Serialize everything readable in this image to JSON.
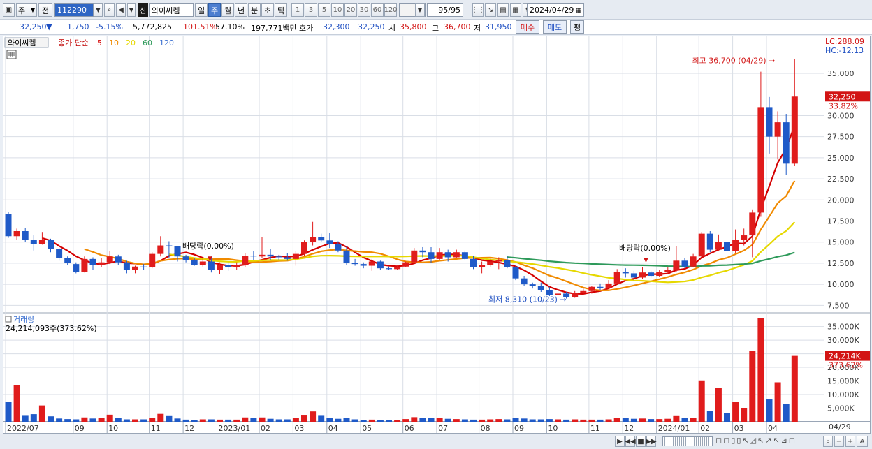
{
  "toolbar": {
    "period_sel": "주",
    "prev_label": "전",
    "code": "112290",
    "market_badge": "신",
    "name": "와이씨켐",
    "period_buttons": [
      "일",
      "주",
      "월",
      "년",
      "분",
      "초",
      "틱"
    ],
    "interval_buttons": [
      "1",
      "3",
      "5",
      "10",
      "20",
      "30",
      "60",
      "120"
    ],
    "count": "95/95",
    "date": "2024/04/29"
  },
  "quote": {
    "price": "32,250",
    "arrow": "▼",
    "change": "1,750",
    "change_pct": "-5.15%",
    "volume": "5,772,825",
    "vol_ratio": "101.51%",
    "turnover_ratio": "57.10%",
    "amount": "197,771백만",
    "hoga_label": "호가",
    "ask": "32,300",
    "bid": "32,250",
    "open_label": "시",
    "open": "35,800",
    "high_label": "고",
    "high": "36,700",
    "low_label": "저",
    "low": "31,950",
    "buy": "매수",
    "sell": "매도",
    "eval": "평"
  },
  "legend": {
    "name": "와이씨켐",
    "ma_label": "종가 단순",
    "ma": [
      {
        "p": "5",
        "color": "#d40000"
      },
      {
        "p": "10",
        "color": "#f08a00"
      },
      {
        "p": "20",
        "color": "#e6d800"
      },
      {
        "p": "60",
        "color": "#2e9a5a"
      },
      {
        "p": "120",
        "color": "#3a6fd0"
      }
    ]
  },
  "right_axis": {
    "lc": "LC:288.09",
    "hc": "HC:-12.13",
    "price_tag": "32,250",
    "price_pct": "33.82%",
    "vol_tag": "24,214K",
    "vol_pct": "373.62%",
    "last_date": "04/29"
  },
  "volume_panel": {
    "title": "거래량",
    "info": "24,214,093주(373.62%)"
  },
  "colors": {
    "up": "#e01c1c",
    "down": "#1f5ac8",
    "panel_bg": "#ffffff",
    "grid": "#d9dee6"
  },
  "chart_data": {
    "type": "candlestick",
    "price_yticks": [
      7500,
      10000,
      12500,
      15000,
      17500,
      20000,
      22500,
      25000,
      27500,
      30000,
      35000
    ],
    "ylim_price": [
      6700,
      37900
    ],
    "volume_yticks": [
      "5,000K",
      "10,000K",
      "15,000K",
      "20,000K",
      "25,000K",
      "30,000K",
      "35,000K"
    ],
    "volume_ytick_values": [
      5000,
      10000,
      15000,
      20000,
      25000,
      30000,
      35000
    ],
    "ylim_volume": [
      0,
      39000
    ],
    "x_labels": [
      "2022/07",
      "09",
      "10",
      "11",
      "12",
      "2023/01",
      "02",
      "03",
      "04",
      "05",
      "06",
      "07",
      "08",
      "09",
      "10",
      "11",
      "12",
      "2024/01",
      "02",
      "03",
      "04"
    ],
    "x_label_index": [
      0,
      8,
      12,
      17,
      21,
      25,
      30,
      34,
      38,
      42,
      47,
      51,
      56,
      60,
      64,
      69,
      73,
      77,
      82,
      86,
      90
    ],
    "candles": [
      [
        18300,
        18600,
        15500,
        15700
      ],
      [
        15700,
        16600,
        15300,
        16300
      ],
      [
        16300,
        16700,
        15000,
        15300
      ],
      [
        15300,
        15800,
        14000,
        14800
      ],
      [
        14800,
        16200,
        14700,
        15300
      ],
      [
        15300,
        15400,
        13800,
        14200
      ],
      [
        14200,
        14300,
        12800,
        13100
      ],
      [
        13100,
        13300,
        12300,
        12500
      ],
      [
        12400,
        12600,
        11300,
        11500
      ],
      [
        11500,
        13300,
        11400,
        13000
      ],
      [
        13000,
        13200,
        11700,
        12300
      ],
      [
        12300,
        13100,
        12000,
        12600
      ],
      [
        12600,
        13900,
        12400,
        13300
      ],
      [
        13300,
        13500,
        12300,
        12600
      ],
      [
        12600,
        12800,
        11300,
        11700
      ],
      [
        11700,
        12200,
        11300,
        12100
      ],
      [
        12100,
        12400,
        11700,
        12000
      ],
      [
        12000,
        13800,
        11900,
        13600
      ],
      [
        13600,
        15700,
        13300,
        14600
      ],
      [
        14600,
        15100,
        13100,
        14500
      ],
      [
        14500,
        14500,
        12700,
        13300
      ],
      [
        13300,
        13500,
        12600,
        12900
      ],
      [
        12900,
        13100,
        12200,
        12300
      ],
      [
        12300,
        13100,
        12100,
        12700
      ],
      [
        12700,
        13300,
        11400,
        11700
      ],
      [
        11700,
        12600,
        11200,
        12300
      ],
      [
        12300,
        12600,
        11600,
        12000
      ],
      [
        12000,
        12600,
        11700,
        12300
      ],
      [
        12300,
        13700,
        12000,
        13400
      ],
      [
        13400,
        13900,
        12900,
        13300
      ],
      [
        13300,
        15600,
        13100,
        13500
      ],
      [
        13500,
        14200,
        12900,
        13300
      ],
      [
        13300,
        13500,
        12900,
        13200
      ],
      [
        13200,
        13700,
        12800,
        13000
      ],
      [
        13000,
        13900,
        12200,
        13600
      ],
      [
        13600,
        15200,
        13400,
        15000
      ],
      [
        15000,
        17400,
        14600,
        15600
      ],
      [
        15600,
        16000,
        15000,
        15200
      ],
      [
        15200,
        16100,
        14300,
        14800
      ],
      [
        14800,
        15100,
        13800,
        14000
      ],
      [
        14000,
        14500,
        12300,
        12500
      ],
      [
        12500,
        13000,
        12200,
        12400
      ],
      [
        12400,
        12600,
        11900,
        12200
      ],
      [
        12200,
        13000,
        11600,
        12700
      ],
      [
        12700,
        12800,
        11700,
        11900
      ],
      [
        11900,
        12100,
        11700,
        11800
      ],
      [
        11800,
        12300,
        11700,
        12100
      ],
      [
        12100,
        12700,
        12000,
        12600
      ],
      [
        12600,
        14300,
        12500,
        14000
      ],
      [
        14000,
        14400,
        13200,
        13800
      ],
      [
        13800,
        14400,
        12500,
        13000
      ],
      [
        13000,
        14300,
        12900,
        13800
      ],
      [
        13800,
        14100,
        12700,
        13200
      ],
      [
        13200,
        14100,
        13100,
        13800
      ],
      [
        13800,
        14000,
        12900,
        13000
      ],
      [
        13000,
        13400,
        11800,
        12000
      ],
      [
        12000,
        12700,
        11300,
        12300
      ],
      [
        12300,
        13100,
        12100,
        12700
      ],
      [
        12700,
        13200,
        11800,
        12900
      ],
      [
        12900,
        13400,
        11900,
        12000
      ],
      [
        12000,
        12200,
        10500,
        10700
      ],
      [
        10700,
        11000,
        9800,
        10000
      ],
      [
        10000,
        10200,
        9500,
        9800
      ],
      [
        9800,
        10200,
        9100,
        9300
      ],
      [
        9300,
        9700,
        8600,
        8700
      ],
      [
        8700,
        9300,
        8400,
        8900
      ],
      [
        8900,
        9100,
        8310,
        8500
      ],
      [
        8500,
        9200,
        8400,
        9000
      ],
      [
        9000,
        9500,
        8700,
        9200
      ],
      [
        9200,
        9800,
        8900,
        9700
      ],
      [
        9700,
        10100,
        9300,
        9600
      ],
      [
        9600,
        10500,
        9500,
        10100
      ],
      [
        10100,
        11800,
        10000,
        11500
      ],
      [
        11500,
        11900,
        10800,
        11300
      ],
      [
        11300,
        11600,
        10400,
        10800
      ],
      [
        10800,
        12000,
        10600,
        11400
      ],
      [
        11400,
        11600,
        10800,
        11000
      ],
      [
        11000,
        11700,
        10900,
        11500
      ],
      [
        11500,
        12000,
        11200,
        11700
      ],
      [
        11700,
        14500,
        11500,
        12800
      ],
      [
        12800,
        13100,
        11900,
        12100
      ],
      [
        12100,
        13600,
        12000,
        13300
      ],
      [
        13300,
        16200,
        13100,
        16000
      ],
      [
        16000,
        16300,
        13800,
        14100
      ],
      [
        14100,
        15900,
        13900,
        15000
      ],
      [
        15000,
        15800,
        13600,
        13900
      ],
      [
        13900,
        16500,
        13700,
        15300
      ],
      [
        15300,
        16600,
        14600,
        15800
      ],
      [
        15800,
        18800,
        13200,
        18500
      ],
      [
        18500,
        35200,
        18000,
        31000
      ],
      [
        31000,
        32200,
        25500,
        27500
      ],
      [
        27500,
        30500,
        24800,
        29200
      ],
      [
        29200,
        30200,
        23000,
        24300
      ],
      [
        24300,
        36700,
        24000,
        32250
      ]
    ],
    "volumes": [
      7200,
      13500,
      2200,
      2800,
      6000,
      2000,
      1200,
      1000,
      900,
      1600,
      1200,
      1300,
      2600,
      1300,
      900,
      900,
      900,
      1400,
      2900,
      2100,
      1200,
      800,
      700,
      900,
      900,
      800,
      800,
      800,
      1600,
      1400,
      1600,
      1100,
      900,
      900,
      1400,
      2300,
      3800,
      2200,
      1500,
      1100,
      1500,
      900,
      700,
      800,
      700,
      600,
      700,
      1000,
      1700,
      1300,
      1300,
      1400,
      1100,
      1000,
      900,
      800,
      800,
      900,
      1000,
      900,
      1500,
      1200,
      900,
      900,
      1000,
      900,
      800,
      900,
      800,
      800,
      800,
      900,
      1400,
      1300,
      1100,
      1200,
      1000,
      1000,
      1100,
      2100,
      1500,
      1300,
      15200,
      4100,
      12500,
      3200,
      7200,
      5100,
      26000,
      38200,
      8200,
      14500,
      6500,
      24214
    ],
    "annotations": {
      "max": "최고 36,700 (04/29)",
      "min": "최저 8,310 (10/23)",
      "div1": "배당락(0.00%)",
      "div2": "배당락(0.00%)"
    }
  }
}
